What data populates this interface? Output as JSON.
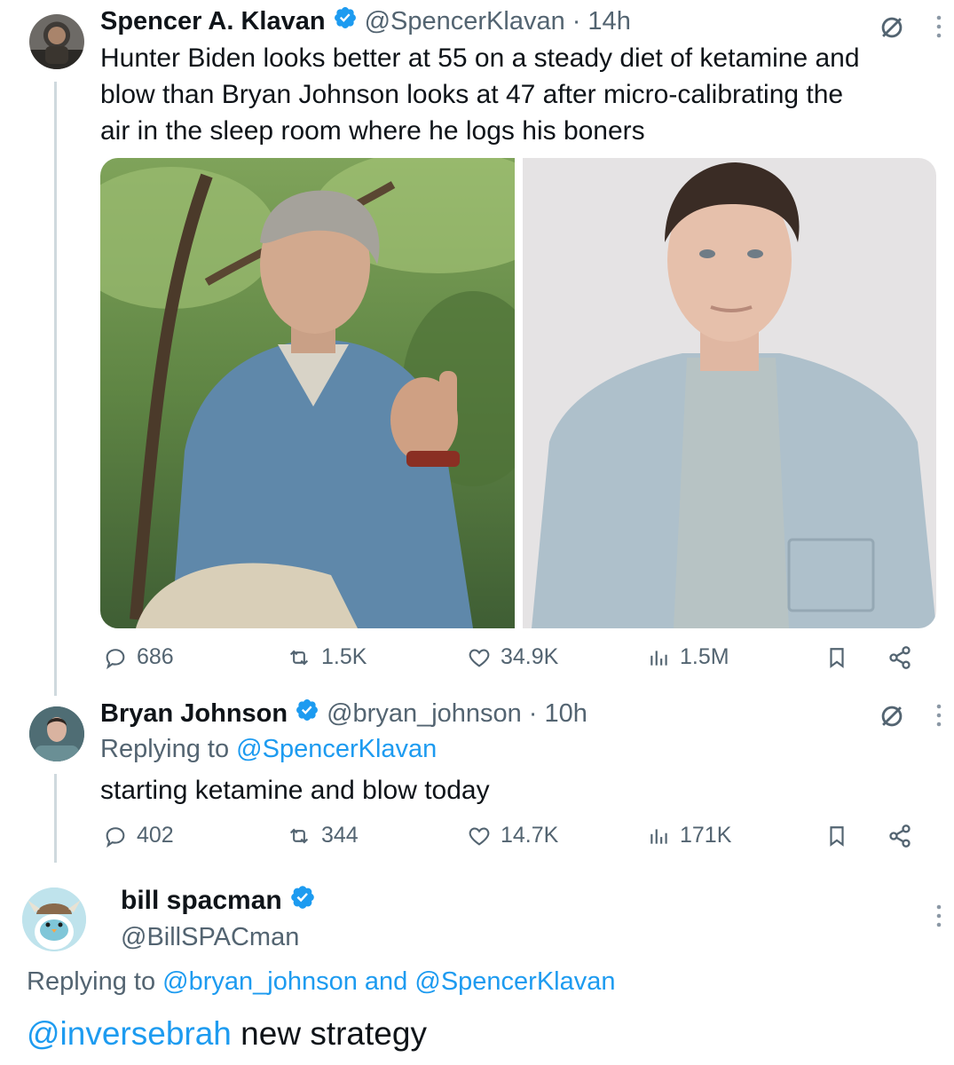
{
  "tweets": [
    {
      "display_name": "Spencer A. Klavan",
      "handle": "@SpencerKlavan",
      "time": "· 14h",
      "text_lines": [
        "Hunter Biden looks better at 55 on a steady diet of ketamine and",
        "blow than Bryan Johnson looks at 47 after micro-calibrating the",
        "air in the sleep room where he logs his boners"
      ],
      "stats": {
        "replies": "686",
        "retweets": "1.5K",
        "likes": "34.9K",
        "views": "1.5M"
      }
    },
    {
      "display_name": "Bryan Johnson",
      "handle": "@bryan_johnson",
      "time": "· 10h",
      "replying_prefix": "Replying to",
      "replying_to": "@SpencerKlavan",
      "text": "starting ketamine and blow today",
      "stats": {
        "replies": "402",
        "retweets": "344",
        "likes": "14.7K",
        "views": "171K"
      }
    },
    {
      "display_name": "bill spacman",
      "handle": "@BillSPACman",
      "replying_prefix": "Replying to",
      "replying_to_a": "@bryan_johnson",
      "replying_and": "and",
      "replying_to_b": "@SpencerKlavan",
      "mention": "@inversebrah",
      "text_rest": " new strategy"
    }
  ],
  "colors": {
    "accent": "#1d9bf0",
    "muted": "#536471",
    "text": "#0f1419",
    "thread_line": "#cfd9de"
  }
}
